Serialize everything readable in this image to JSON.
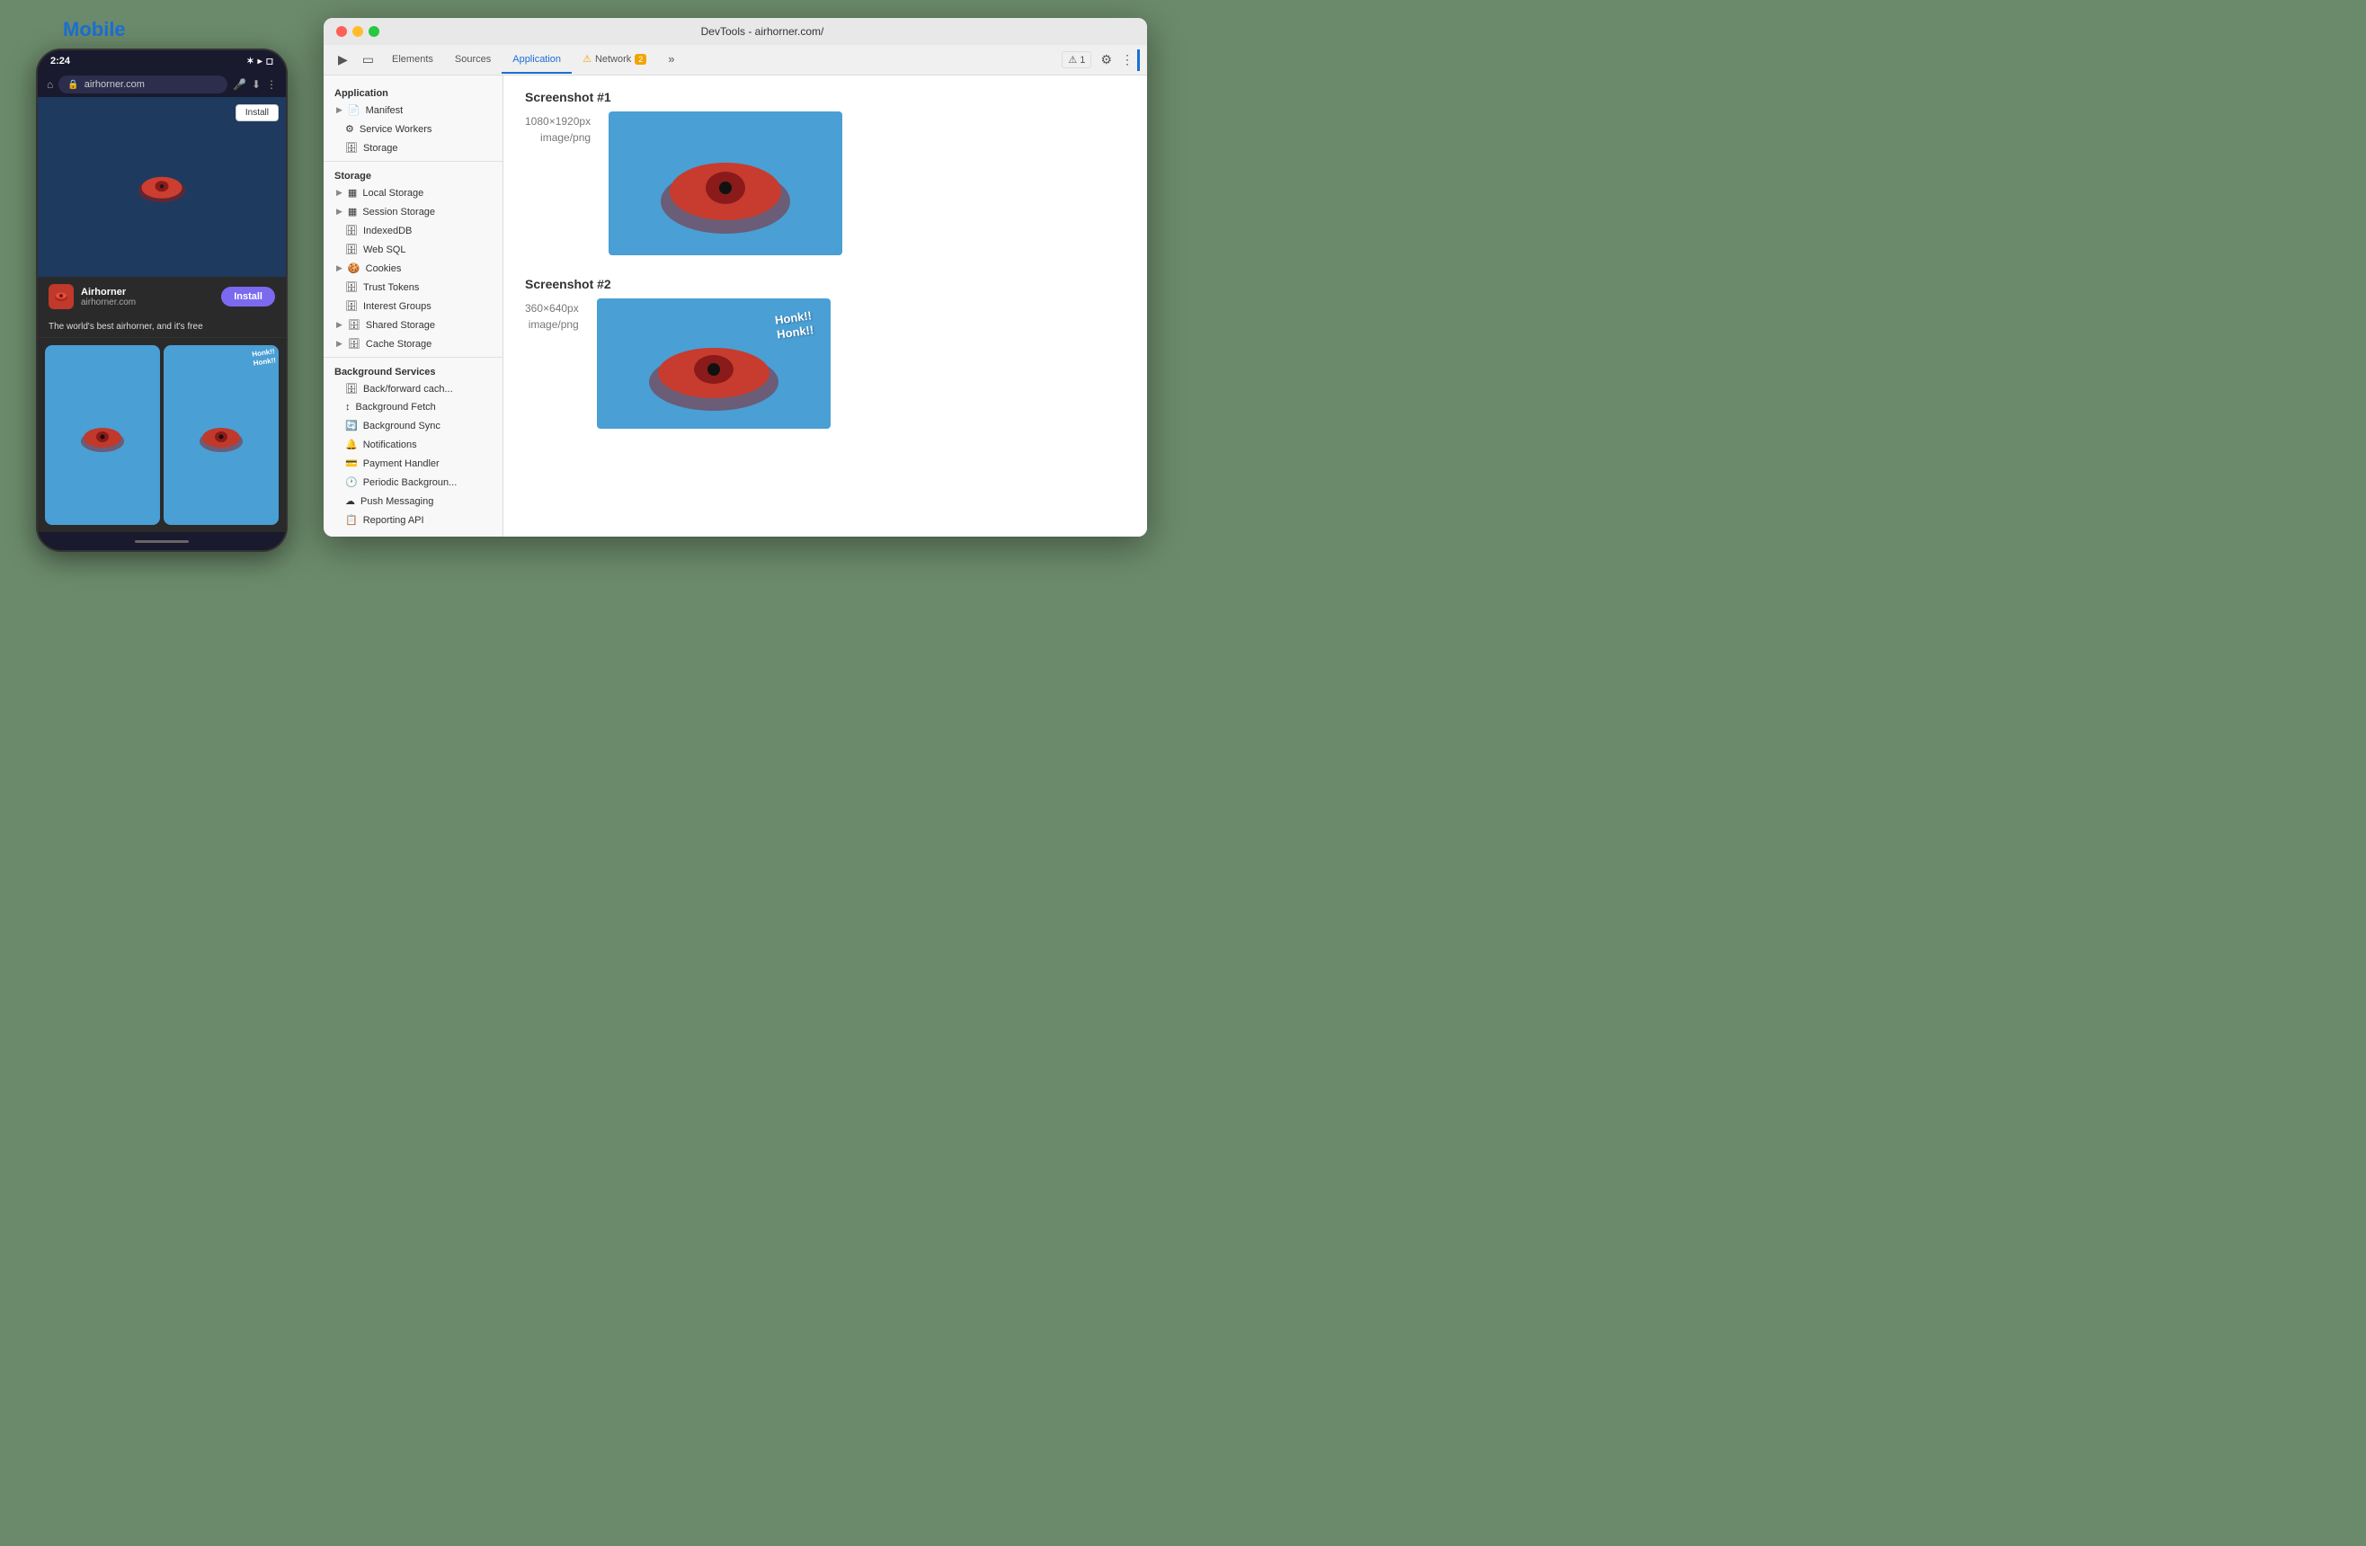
{
  "page": {
    "mobile_label": "Mobile",
    "phone": {
      "time": "2:24",
      "url": "airhorner.com",
      "install_btn_top": "Install",
      "app_name": "Airhorner",
      "app_domain": "airhorner.com",
      "install_btn_banner": "Install",
      "description": "The world's best airhorner, and it's free",
      "honk_text": "Honk!!\nHonk!!"
    },
    "devtools": {
      "title": "DevTools - airhorner.com/",
      "tabs": [
        {
          "label": "Elements",
          "active": false
        },
        {
          "label": "Sources",
          "active": false
        },
        {
          "label": "Application",
          "active": true
        },
        {
          "label": "Network",
          "active": false,
          "warning": true,
          "warning_count": "⚠ 2"
        }
      ],
      "sidebar": {
        "sections": [
          {
            "header": "Application",
            "items": [
              {
                "label": "Manifest",
                "icon": "📄",
                "arrow": true,
                "selected": false
              },
              {
                "label": "Service Workers",
                "icon": "⚙️",
                "selected": false
              },
              {
                "label": "Storage",
                "icon": "🗄️",
                "selected": false
              }
            ]
          },
          {
            "header": "Storage",
            "items": [
              {
                "label": "Local Storage",
                "icon": "▦",
                "arrow": true,
                "selected": false
              },
              {
                "label": "Session Storage",
                "icon": "▦",
                "arrow": true,
                "selected": false
              },
              {
                "label": "IndexedDB",
                "icon": "🗄️",
                "selected": false
              },
              {
                "label": "Web SQL",
                "icon": "🗄️",
                "selected": false
              },
              {
                "label": "Cookies",
                "icon": "🍪",
                "arrow": true,
                "selected": false
              },
              {
                "label": "Trust Tokens",
                "icon": "🗄️",
                "selected": false
              },
              {
                "label": "Interest Groups",
                "icon": "🗄️",
                "selected": false
              },
              {
                "label": "Shared Storage",
                "icon": "🗄️",
                "arrow": true,
                "selected": false
              },
              {
                "label": "Cache Storage",
                "icon": "🗄️",
                "arrow": true,
                "selected": false
              }
            ]
          },
          {
            "header": "Background Services",
            "items": [
              {
                "label": "Back/forward cache",
                "icon": "🗄️",
                "selected": false
              },
              {
                "label": "Background Fetch",
                "icon": "↕",
                "selected": false
              },
              {
                "label": "Background Sync",
                "icon": "🔄",
                "selected": false
              },
              {
                "label": "Notifications",
                "icon": "🔔",
                "selected": false
              },
              {
                "label": "Payment Handler",
                "icon": "💳",
                "selected": false
              },
              {
                "label": "Periodic Background...",
                "icon": "🕐",
                "selected": false
              },
              {
                "label": "Push Messaging",
                "icon": "☁️",
                "selected": false
              },
              {
                "label": "Reporting API",
                "icon": "📋",
                "selected": false
              }
            ]
          }
        ]
      },
      "main": {
        "screenshot1": {
          "title": "Screenshot #1",
          "dimensions": "1080×1920px",
          "type": "image/png"
        },
        "screenshot2": {
          "title": "Screenshot #2",
          "dimensions": "360×640px",
          "type": "image/png"
        }
      }
    }
  }
}
